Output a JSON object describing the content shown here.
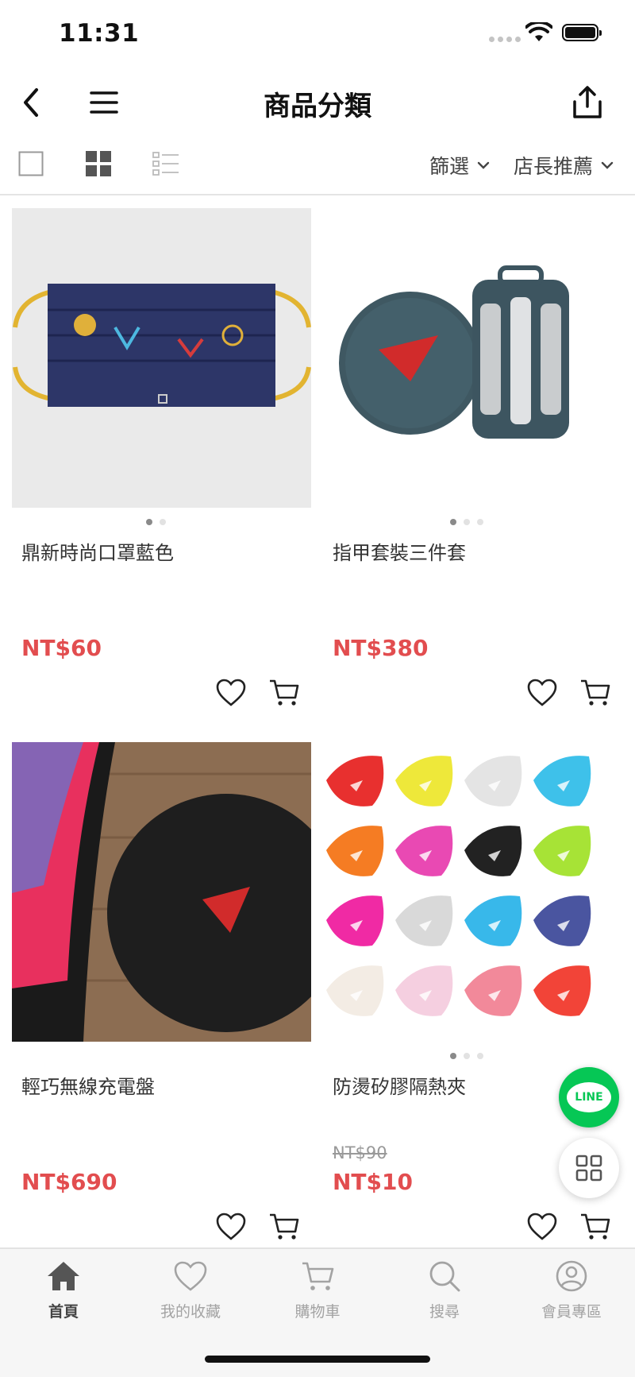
{
  "status_bar": {
    "time": "11:31"
  },
  "header": {
    "title": "商品分類"
  },
  "toolbar": {
    "view_modes": [
      "single-view-icon",
      "grid-view-icon",
      "list-view-icon"
    ],
    "filter_label": "篩選",
    "sort_label": "店長推薦"
  },
  "products": [
    {
      "name": "鼎新時尚口罩藍色",
      "price": "NT$60",
      "image_dots": 2,
      "active_dot": 0
    },
    {
      "name": "指甲套裝三件套",
      "price": "NT$380",
      "image_dots": 3,
      "active_dot": 0
    },
    {
      "name": "輕巧無線充電盤",
      "price": "NT$690",
      "image_dots": 0,
      "active_dot": 0
    },
    {
      "name": "防燙矽膠隔熱夾",
      "original_price": "NT$90",
      "price": "NT$10",
      "image_dots": 3,
      "active_dot": 0
    }
  ],
  "floating": {
    "line_label": "LINE"
  },
  "tabbar": {
    "items": [
      {
        "label": "首頁",
        "icon": "home-icon",
        "active": true
      },
      {
        "label": "我的收藏",
        "icon": "heart-icon",
        "active": false
      },
      {
        "label": "購物車",
        "icon": "cart-icon",
        "active": false
      },
      {
        "label": "搜尋",
        "icon": "search-icon",
        "active": false
      },
      {
        "label": "會員專區",
        "icon": "user-icon",
        "active": false
      }
    ]
  },
  "colors": {
    "price": "#e24d4f",
    "line_green": "#06c755"
  }
}
